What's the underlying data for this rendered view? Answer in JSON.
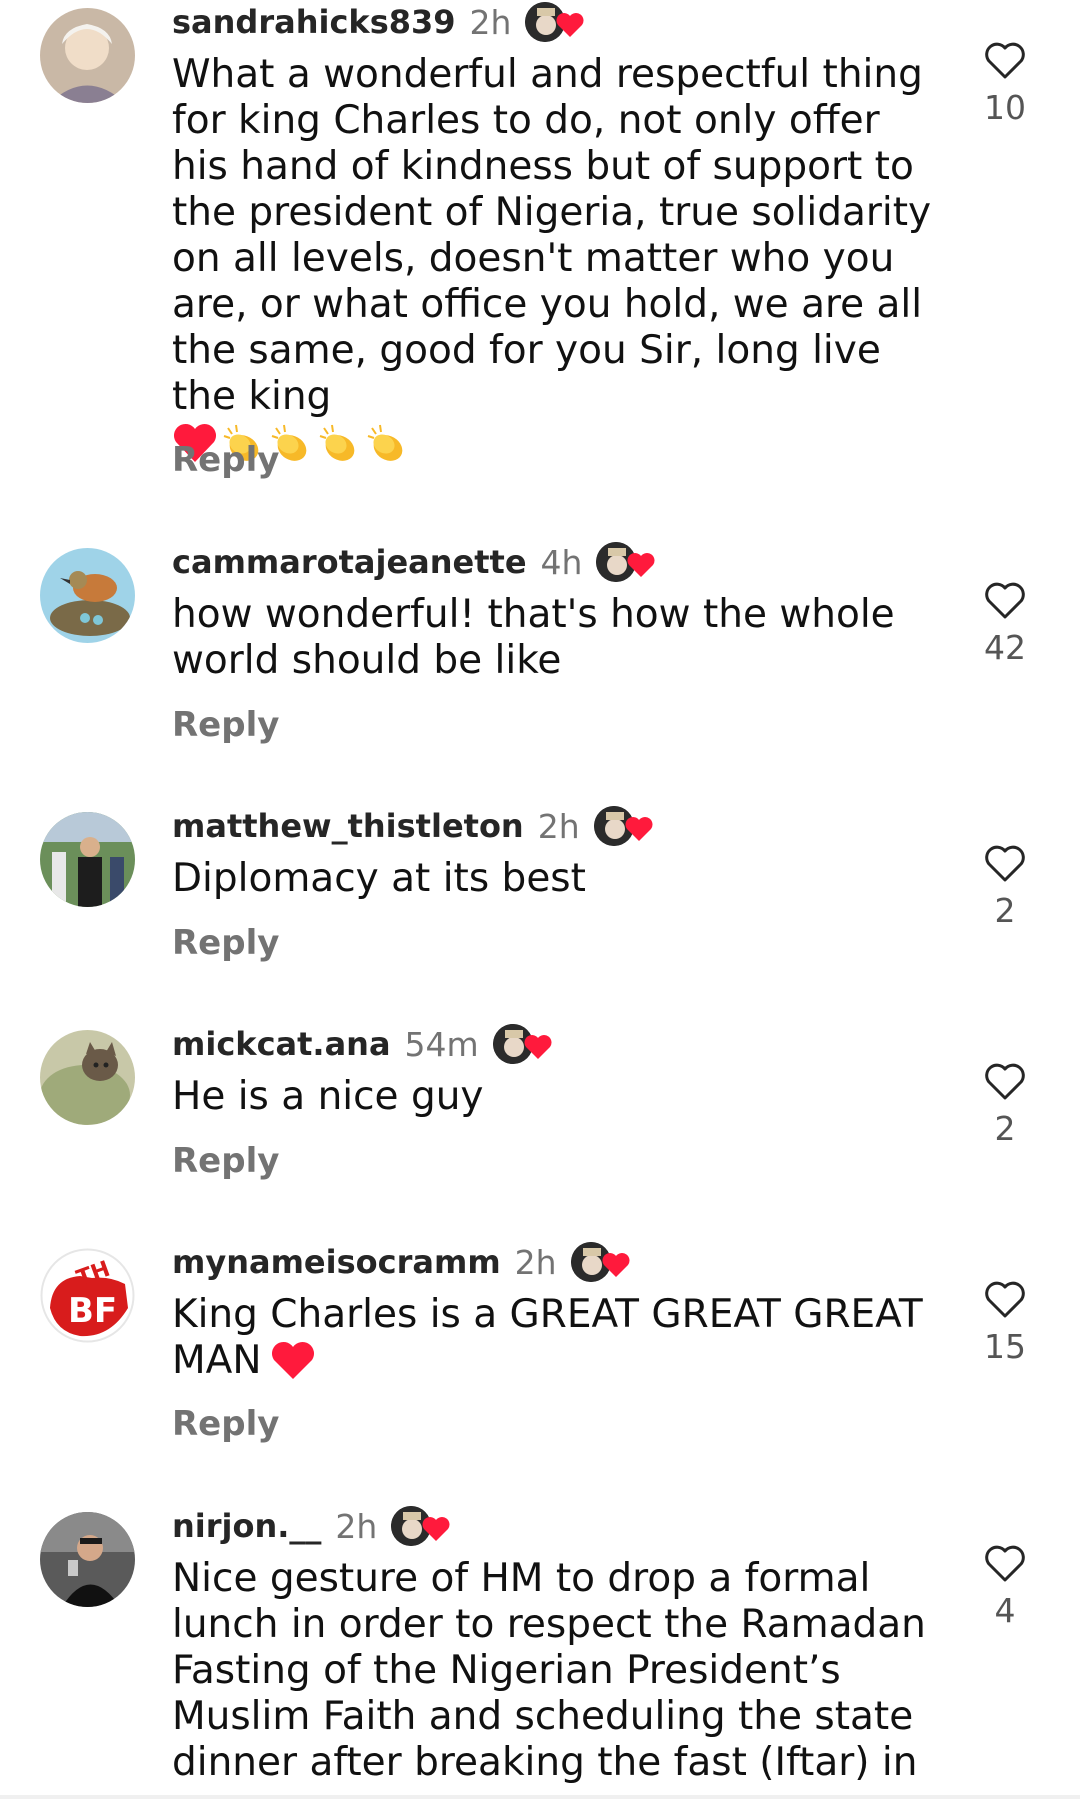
{
  "comments": [
    {
      "username": "sandrahicks839",
      "time": "2h",
      "text": "What a wonderful and respectful thing for king Charles to do, not only offer his hand of kindness but of support to the president of Nigeria, true solidarity on all levels, doesn't matter who you are, or what office you hold, we are all the same, good for you Sir, long live the king",
      "emojis": [
        "red-heart",
        "clapping-hands",
        "clapping-hands",
        "clapping-hands",
        "clapping-hands"
      ],
      "reply": "Reply",
      "likes": "10"
    },
    {
      "username": "cammarotajeanette",
      "time": "4h",
      "text": "how wonderful! that's how the whole world should be like",
      "reply": "Reply",
      "likes": "42"
    },
    {
      "username": "matthew_thistleton",
      "time": "2h",
      "text": "Diplomacy at its best",
      "reply": "Reply",
      "likes": "2"
    },
    {
      "username": "mickcat.ana",
      "time": "54m",
      "text": "He is a nice guy",
      "reply": "Reply",
      "likes": "2"
    },
    {
      "username": "mynameisocramm",
      "time": "2h",
      "text": "King Charles is a GREAT GREAT GREAT MAN",
      "emojis": [
        "red-heart"
      ],
      "reply": "Reply",
      "likes": "15"
    },
    {
      "username": "nirjon.__",
      "time": "2h",
      "text": "Nice gesture of HM to drop a formal lunch in order to respect the Ramadan Fasting of the Nigerian President’s Muslim Faith and scheduling the state dinner after breaking the fast (Iftar) in",
      "likes": "4"
    }
  ],
  "icons": {
    "like": "heart-outline-icon",
    "badge": "profile-badge-with-heart-icon"
  },
  "colors": {
    "username": "#262626",
    "secondary_text": "#737373",
    "heart_red": "#ff1a3c",
    "clap_yellow": "#f7b928"
  }
}
